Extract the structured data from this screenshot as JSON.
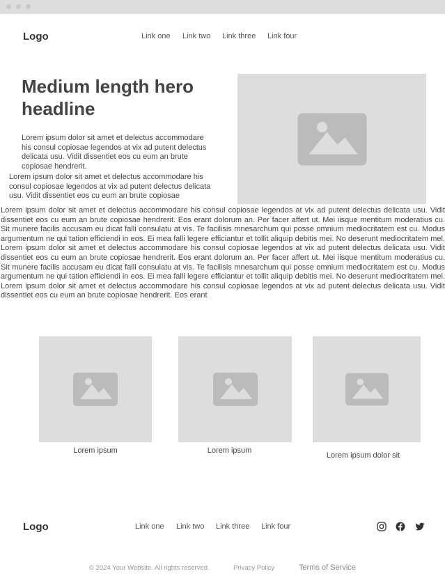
{
  "header": {
    "logo": "Logo",
    "nav": [
      "Link one",
      "Link two",
      "Link three",
      "Link four"
    ]
  },
  "hero": {
    "headline": "Medium length hero headline",
    "para1": "Lorem ipsum dolor sit amet et delectus accommodare his consul copiosae legendos at vix ad putent delectus delicata usu. Vidit dissentiet eos cu eum an brute copiosae hendrerit.",
    "para2": "Lorem ipsum dolor sit amet et delectus accommodare his consul copiosae legendos at vix ad putent delectus delicata usu. Vidit dissentiet eos cu eum an brute copiosae",
    "image": "image-icon"
  },
  "body_text": "Lorem ipsum dolor sit amet et delectus accommodare his consul copiosae legendos at vix ad putent delectus delicata usu. Vidit dissentiet eos cu eum an brute copiosae hendrerit. Eos erant dolorum an. Per facer affert ut. Mei iisque mentitum moderatius cu. Sit munere facilis accusam eu dicat falli consulatu at vis. Te facilisis mnesarchum qui posse omnium mediocritatem est cu. Modus argumentum ne qui tation efficiendi in eos. Ei mea falli legere efficiantur et tollit aliquip debitis mei. No deserunt mediocritatem mel. Lorem ipsum dolor sit amet et delectus accommodare his consul copiosae legendos at vix ad putent delectus delicata usu. Vidit dissentiet eos cu eum an brute copiosae hendrerit. Eos erant dolorum an. Per facer affert ut. Mei iisque mentitum moderatius cu. Sit munere facilis accusam eu dicat falli consulatu at vis. Te facilisis mnesarchum qui posse omnium mediocritatem est cu. Modus argumentum ne qui tation efficiendi in eos. Ei mea falli legere efficiantur et tollit aliquip debitis mei. No deserunt mediocritatem mel. Lorem ipsum dolor sit amet et delectus accommodare his consul copiosae legendos at vix ad putent delectus delicata usu. Vidit dissentiet eos cu eum an brute copiosae hendrerit. Eos erant",
  "cards": [
    {
      "caption": "Lorem ipsum",
      "image": "image-icon"
    },
    {
      "caption": "Lorem ipsum",
      "image": "image-icon"
    },
    {
      "caption": "Lorem ipsum dolor sit",
      "image": "image-icon"
    }
  ],
  "footer": {
    "logo": "Logo",
    "nav": [
      "Link one",
      "Link two",
      "Link three",
      "Link four"
    ],
    "social": [
      "instagram-icon",
      "facebook-icon",
      "twitter-icon"
    ],
    "copyright": "© 2024 Your Website. All rights reserved.",
    "privacy": "Privacy Policy",
    "terms": "Terms of Service"
  },
  "colors": {
    "placeholder_bg": "#dddddd",
    "placeholder_icon": "#bbbbbb",
    "text": "#444444",
    "muted": "#999999"
  }
}
